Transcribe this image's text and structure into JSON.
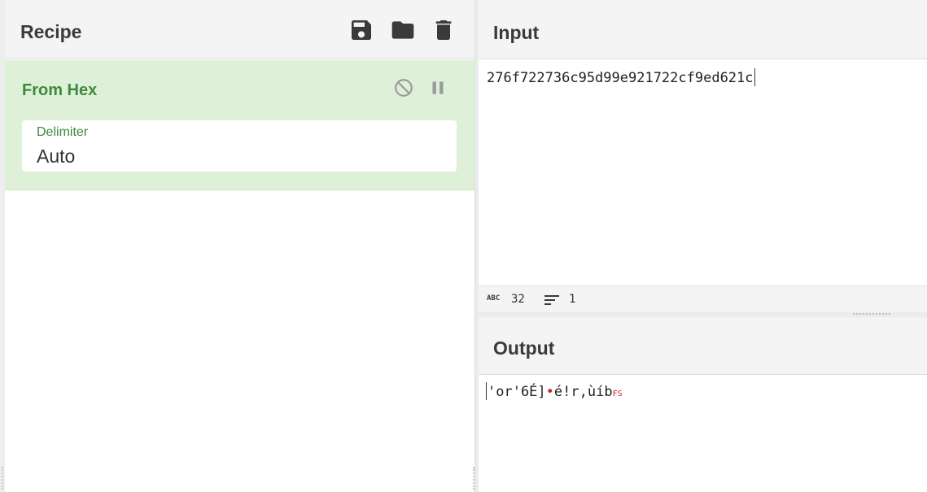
{
  "recipe": {
    "title": "Recipe",
    "icons": [
      "save-icon",
      "folder-icon",
      "trash-icon"
    ],
    "operation": {
      "name": "From Hex",
      "icons": [
        "disable-icon",
        "pause-icon"
      ],
      "argument": {
        "label": "Delimiter",
        "value": "Auto"
      }
    }
  },
  "input": {
    "title": "Input",
    "text": "276f722736c95d99e921722cf9ed621c",
    "status": {
      "abc_label": "ABC",
      "length": "32",
      "lines": "1"
    }
  },
  "output": {
    "title": "Output",
    "text_part1": "'or'6É]",
    "dot": "•",
    "text_part2": "é!r,ùíb",
    "control_char": "FS"
  },
  "colors": {
    "operation_bg": "#dff0d8",
    "operation_title": "#3c8a3c",
    "header_bg": "#f4f4f4",
    "special_char": "#cc2222"
  }
}
